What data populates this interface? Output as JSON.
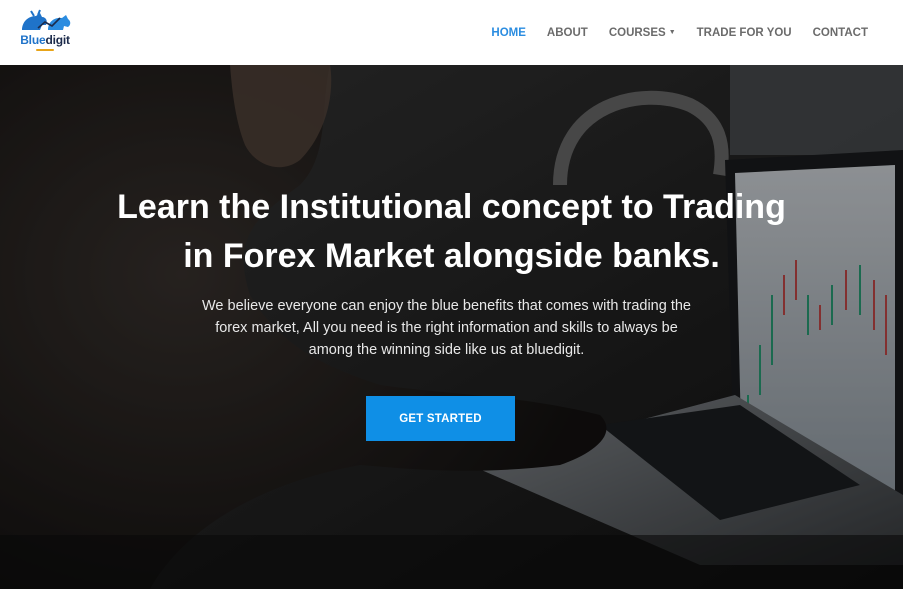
{
  "brand": {
    "logo_text_part1": "Blue",
    "logo_text_part2": "digit",
    "logo_icon": "bull-bear-icon",
    "accent_color": "#1f73c9"
  },
  "nav": {
    "items": [
      {
        "label": "HOME",
        "active": true
      },
      {
        "label": "ABOUT",
        "active": false
      },
      {
        "label": "COURSES",
        "active": false,
        "has_dropdown": true
      },
      {
        "label": "TRADE FOR YOU",
        "active": false
      },
      {
        "label": "CONTACT",
        "active": false
      }
    ],
    "active_color": "#2a8ce0",
    "dropdown_icon": "caret-down-icon"
  },
  "hero": {
    "title_line1": "Learn the Institutional concept to Trading",
    "title_line2": "in Forex Market alongside banks.",
    "text_line1": "We believe everyone can enjoy the blue benefits that comes with trading the",
    "text_line2": "forex market, All you need is the right information and skills to always be",
    "text_line3": "among the winning side like us at bluedigit.",
    "cta_label": "GET STARTED",
    "cta_color": "#0f8fe6"
  }
}
